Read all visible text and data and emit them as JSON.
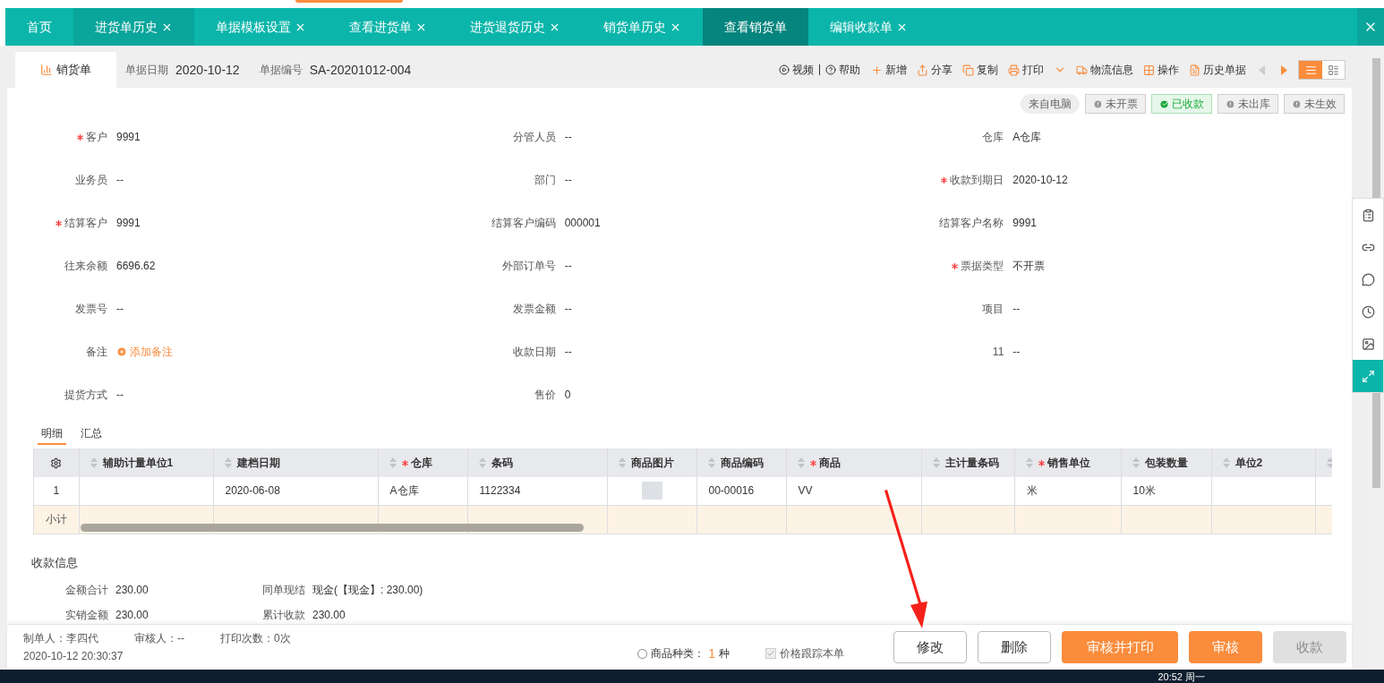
{
  "tabs": [
    {
      "label": "首页",
      "closable": false,
      "selected": false
    },
    {
      "label": "进货单历史",
      "closable": true,
      "selected": false
    },
    {
      "label": "单据模板设置",
      "closable": true,
      "selected": false
    },
    {
      "label": "查看进货单",
      "closable": true,
      "selected": false
    },
    {
      "label": "进货退货历史",
      "closable": true,
      "selected": false
    },
    {
      "label": "销货单历史",
      "closable": true,
      "selected": false
    },
    {
      "label": "查看销货单",
      "closable": false,
      "selected": true
    },
    {
      "label": "编辑收款单",
      "closable": true,
      "selected": false
    }
  ],
  "header": {
    "doc_tab": "销货单",
    "date_label": "单据日期",
    "date": "2020-10-12",
    "number_label": "单据编号",
    "number": "SA-20201012-004"
  },
  "help_links": [
    "视频",
    "帮助"
  ],
  "actions": [
    "新增",
    "分享",
    "复制",
    "打印",
    "物流信息",
    "操作",
    "历史单据"
  ],
  "badges": [
    {
      "label": "来自电脑",
      "kind": "source"
    },
    {
      "label": "未开票",
      "kind": "pending"
    },
    {
      "label": "已收款",
      "kind": "done"
    },
    {
      "label": "未出库",
      "kind": "pending"
    },
    {
      "label": "未生效",
      "kind": "pending"
    }
  ],
  "fields": [
    {
      "label": "客户",
      "value": "9991",
      "required": true
    },
    {
      "label": "分管人员",
      "value": "--",
      "required": false
    },
    {
      "label": "仓库",
      "value": "A仓库",
      "required": false
    },
    {
      "label": "业务员",
      "value": "--",
      "required": false
    },
    {
      "label": "部门",
      "value": "--",
      "required": false
    },
    {
      "label": "收款到期日",
      "value": "2020-10-12",
      "required": true
    },
    {
      "label": "结算客户",
      "value": "9991",
      "required": true
    },
    {
      "label": "结算客户编码",
      "value": "000001",
      "required": false
    },
    {
      "label": "结算客户名称",
      "value": "9991",
      "required": false
    },
    {
      "label": "往来余额",
      "value": "6696.62",
      "required": false
    },
    {
      "label": "外部订单号",
      "value": "--",
      "required": false
    },
    {
      "label": "票据类型",
      "value": "不开票",
      "required": true
    },
    {
      "label": "发票号",
      "value": "--",
      "required": false
    },
    {
      "label": "发票金额",
      "value": "--",
      "required": false
    },
    {
      "label": "项目",
      "value": "--",
      "required": false
    },
    {
      "label": "备注",
      "value": "添加备注",
      "required": false,
      "kind": "link"
    },
    {
      "label": "收款日期",
      "value": "--",
      "required": false
    },
    {
      "label": "11",
      "value": "--",
      "required": false
    },
    {
      "label": "提货方式",
      "value": "--",
      "required": false
    },
    {
      "label": "售价",
      "value": "0",
      "required": false
    }
  ],
  "sub_tabs": [
    {
      "label": "明细",
      "selected": true
    },
    {
      "label": "汇总",
      "selected": false
    }
  ],
  "table": {
    "columns": [
      {
        "label": "辅助计量单位1",
        "required": false
      },
      {
        "label": "建档日期",
        "required": false
      },
      {
        "label": "仓库",
        "required": true
      },
      {
        "label": "条码",
        "required": false
      },
      {
        "label": "商品图片",
        "required": false
      },
      {
        "label": "商品编码",
        "required": false
      },
      {
        "label": "商品",
        "required": true
      },
      {
        "label": "主计量条码",
        "required": false
      },
      {
        "label": "销售单位",
        "required": true
      },
      {
        "label": "包装数量",
        "required": false
      },
      {
        "label": "单位2",
        "required": false
      }
    ],
    "rows": [
      {
        "index": "1",
        "cells": [
          "",
          "2020-06-08",
          "A仓库",
          "1122334",
          "",
          "00-00016",
          "VV",
          "",
          "米",
          "10米",
          ""
        ]
      }
    ],
    "subtotal_label": "小计"
  },
  "payment": {
    "title": "收款信息",
    "items": [
      {
        "label": "金额合计",
        "value": "230.00"
      },
      {
        "label": "同单现结",
        "value": "现金(【现金】: 230.00)"
      },
      {
        "label": "实销金额",
        "value": "230.00"
      },
      {
        "label": "累计收款",
        "value": "230.00"
      }
    ]
  },
  "footer": {
    "creator": "制单人：李四代",
    "reviewer": "审核人：--",
    "prints": "打印次数：0次",
    "created": "2020-10-12 20:30:37",
    "kinds_label": "商品种类：",
    "kinds_count": "1",
    "kinds_unit": "种",
    "track": {
      "label": "价格跟踪本单",
      "checked": true
    },
    "buttons": [
      {
        "label": "修改",
        "kind": "outline"
      },
      {
        "label": "删除",
        "kind": "outline"
      },
      {
        "label": "审核并打印",
        "kind": "primary"
      },
      {
        "label": "审核",
        "kind": "primary"
      },
      {
        "label": "收款",
        "kind": "disabled"
      }
    ]
  },
  "taskbar": {
    "clock": "20:52 周一"
  }
}
